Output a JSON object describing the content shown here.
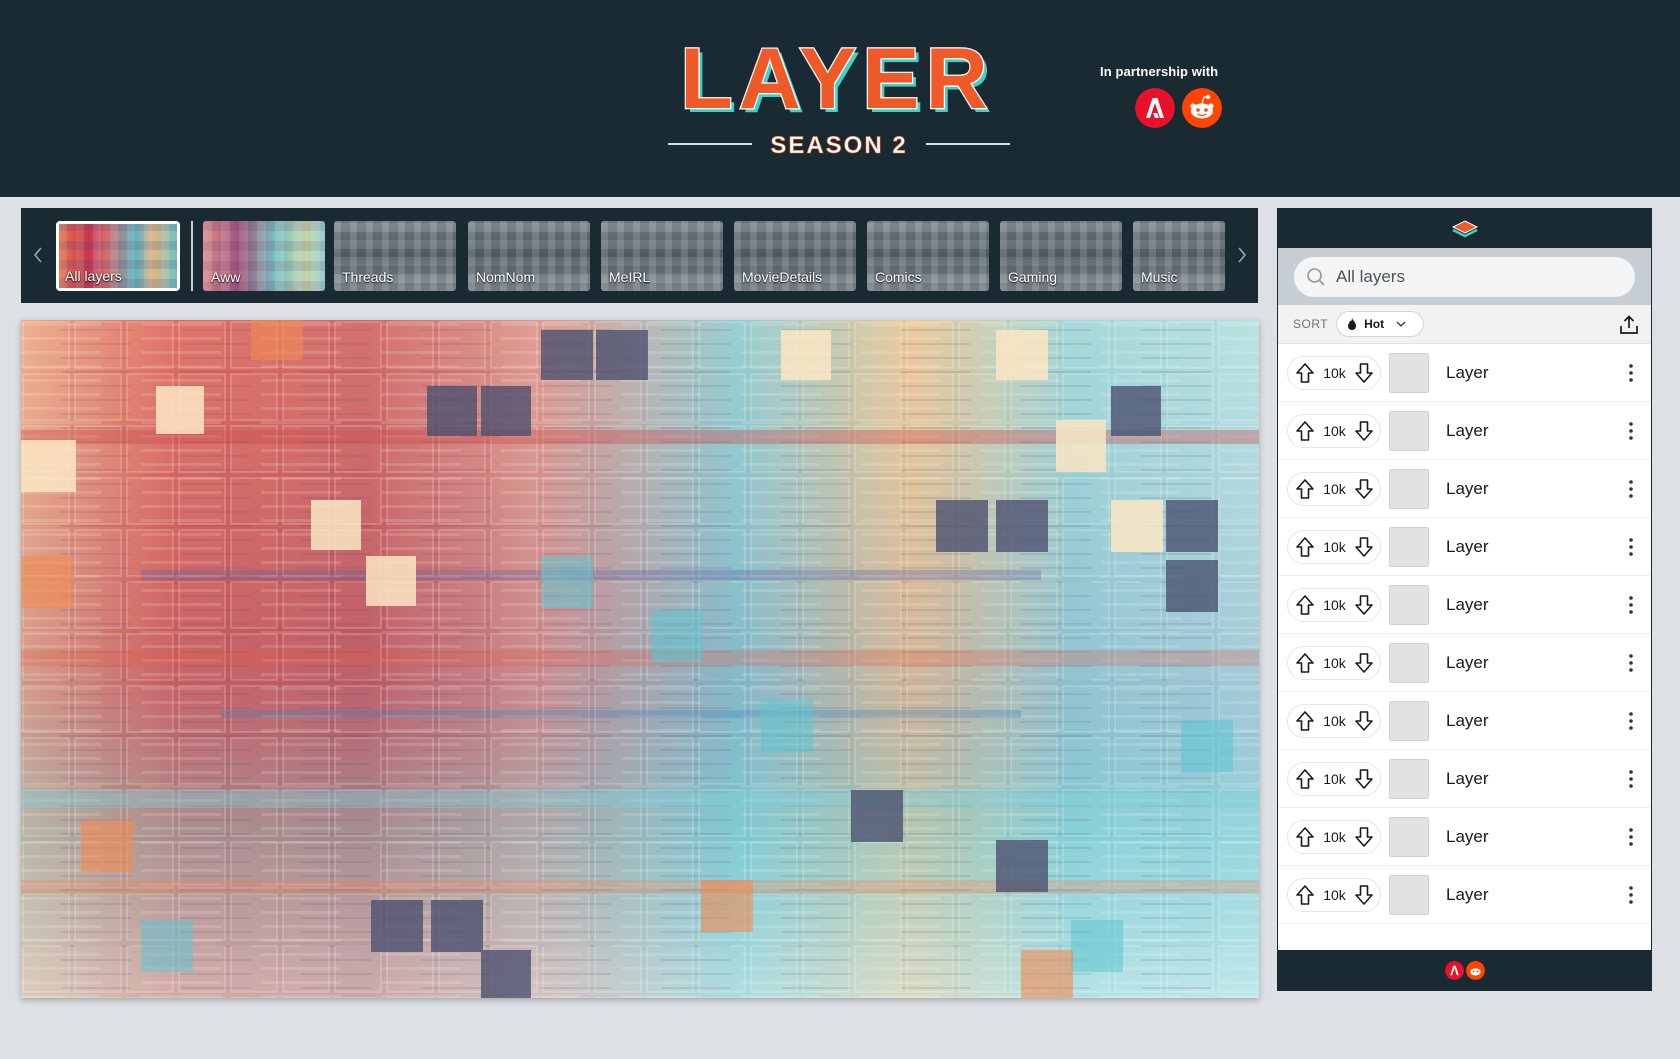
{
  "header": {
    "title": "LAYER",
    "subtitle": "SEASON 2",
    "partnership_text": "In partnership with",
    "partners": [
      "adobe-logo",
      "reddit-logo"
    ]
  },
  "thumbnails": [
    {
      "label": "All layers",
      "active": true
    },
    {
      "label": "Aww",
      "active": false
    },
    {
      "label": "Threads",
      "active": false
    },
    {
      "label": "NomNom",
      "active": false
    },
    {
      "label": "MeIRL",
      "active": false
    },
    {
      "label": "MovieDetails",
      "active": false
    },
    {
      "label": "Comics",
      "active": false
    },
    {
      "label": "Gaming",
      "active": false
    },
    {
      "label": "Music",
      "active": false
    }
  ],
  "panel": {
    "search": {
      "placeholder": "All layers",
      "value": ""
    },
    "sort": {
      "label": "SORT",
      "value": "Hot",
      "icon": "flame-icon"
    },
    "rows": [
      {
        "votes": "10k",
        "title": "Layer"
      },
      {
        "votes": "10k",
        "title": "Layer"
      },
      {
        "votes": "10k",
        "title": "Layer"
      },
      {
        "votes": "10k",
        "title": "Layer"
      },
      {
        "votes": "10k",
        "title": "Layer"
      },
      {
        "votes": "10k",
        "title": "Layer"
      },
      {
        "votes": "10k",
        "title": "Layer"
      },
      {
        "votes": "10k",
        "title": "Layer"
      },
      {
        "votes": "10k",
        "title": "Layer"
      },
      {
        "votes": "10k",
        "title": "Layer"
      }
    ]
  },
  "colors": {
    "header_bg": "#1a2a33",
    "title_orange": "#f05a28",
    "title_teal": "#3fd1c9",
    "adobe_red": "#e8102b",
    "reddit_orange": "#ff4500",
    "page_bg": "#dde1e5"
  }
}
